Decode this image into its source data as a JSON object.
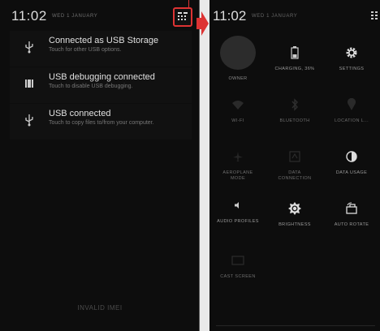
{
  "notification_shade": {
    "clock": "11:02",
    "date": "WED 1 JANUARY",
    "quick_settings_toggle_icon": "quick-settings-grid-icon",
    "notifications": [
      {
        "icon": "usb-icon",
        "title": "Connected as USB Storage",
        "subtitle": "Touch for other USB options."
      },
      {
        "icon": "debug-square-icon",
        "title": "USB debugging connected",
        "subtitle": "Touch to disable USB debugging."
      },
      {
        "icon": "usb-icon",
        "title": "USB connected",
        "subtitle": "Touch to copy files to/from your computer."
      }
    ],
    "footer": "INVALID IMEI"
  },
  "quick_settings": {
    "clock": "11:02",
    "date": "WED 1 JANUARY",
    "tiles": [
      {
        "label": "OWNER",
        "icon": "avatar-circle"
      },
      {
        "label": "CHARGING, 36%",
        "icon": "battery-icon"
      },
      {
        "label": "SETTINGS",
        "icon": "gear-icon"
      },
      {
        "label": "WI-FI",
        "icon": "wifi-icon"
      },
      {
        "label": "BLUETOOTH",
        "icon": "bluetooth-icon"
      },
      {
        "label": "LOCATION L...",
        "icon": "location-icon"
      },
      {
        "label": "AEROPLANE MODE",
        "icon": "airplane-icon"
      },
      {
        "label": "DATA CONNECTION",
        "icon": "data-icon"
      },
      {
        "label": "DATA USAGE",
        "icon": "data-usage-icon"
      },
      {
        "label": "AUDIO PROFILES",
        "icon": "speaker-icon"
      },
      {
        "label": "BRIGHTNESS",
        "icon": "brightness-icon"
      },
      {
        "label": "AUTO ROTATE",
        "icon": "rotate-icon"
      },
      {
        "label": "CAST SCREEN",
        "icon": "cast-icon"
      }
    ]
  },
  "colors": {
    "background": "#0d0d0d",
    "highlight": "#dd3333",
    "text_primary": "#e0e0e0",
    "text_secondary": "#777777"
  }
}
